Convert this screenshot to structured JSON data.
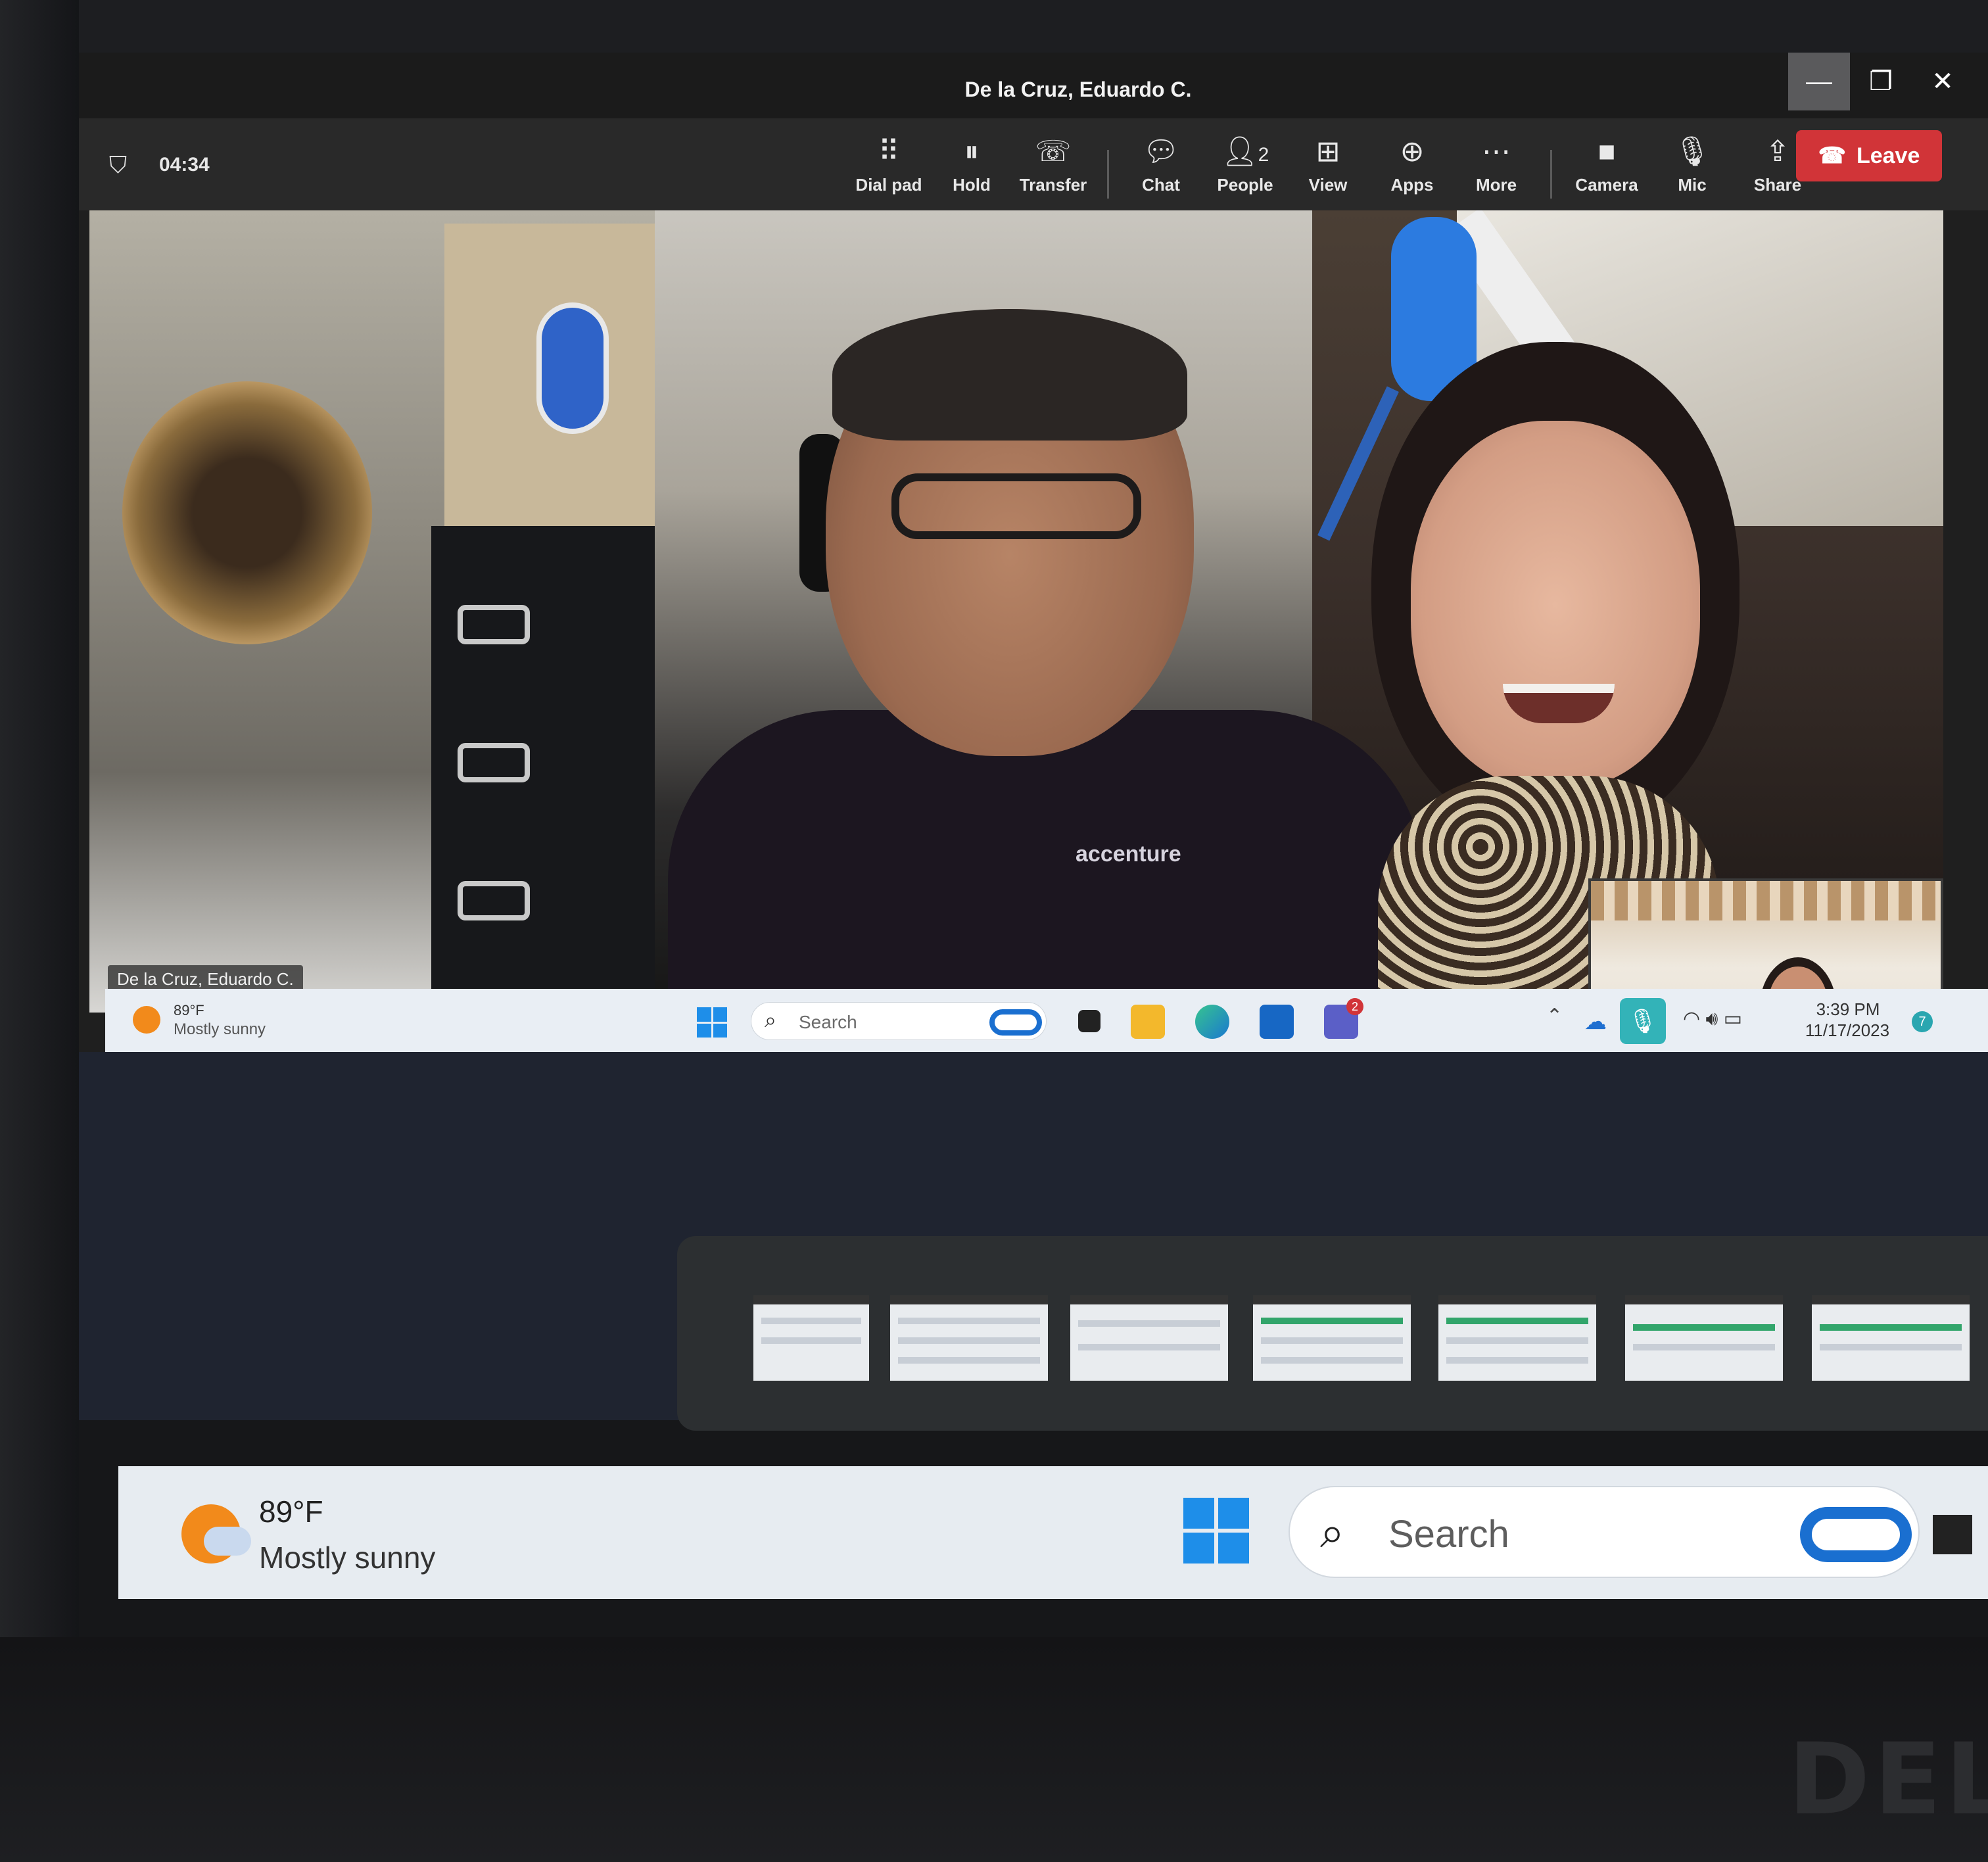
{
  "window": {
    "title": "De la Cruz, Eduardo C.",
    "minimize": "—",
    "maximize": "❐",
    "close": "✕"
  },
  "meeting": {
    "timer": "04:34",
    "toolbar": {
      "dial_pad": "Dial pad",
      "hold": "Hold",
      "transfer": "Transfer",
      "chat": "Chat",
      "people": "People",
      "people_count": "2",
      "view": "View",
      "apps": "Apps",
      "more": "More",
      "camera": "Camera",
      "mic": "Mic",
      "share": "Share",
      "leave": "Leave"
    },
    "participant_name": "De la Cruz, Eduardo C.",
    "shirt_text": "accenture"
  },
  "remote_taskbar": {
    "temperature": "89°F",
    "condition": "Mostly sunny",
    "search_placeholder": "Search",
    "time": "3:39 PM",
    "date": "11/17/2023",
    "teams_badge": "2",
    "notification_badge": "7"
  },
  "task_view": {
    "thumbnail_count": 7
  },
  "local_taskbar": {
    "temperature": "89°F",
    "condition": "Mostly sunny",
    "search_placeholder": "Search"
  },
  "monitor": {
    "brand": "DELL"
  },
  "colors": {
    "leave": "#d13438",
    "accent": "#1e8ee9",
    "mic_active": "#33b3b8"
  }
}
